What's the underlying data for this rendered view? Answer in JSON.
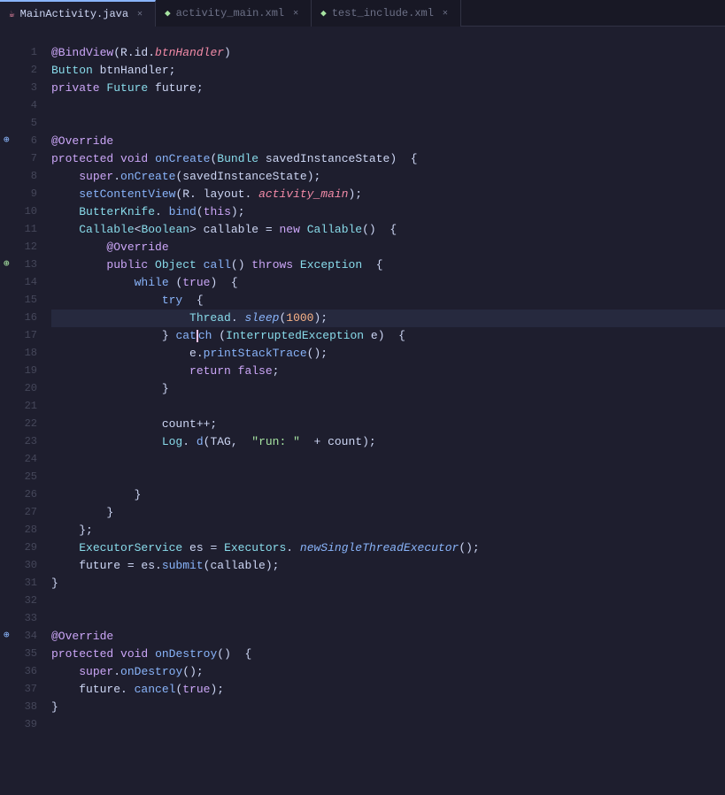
{
  "tabs": [
    {
      "id": "main-activity",
      "label": "MainActivity.java",
      "type": "java",
      "active": true
    },
    {
      "id": "activity-main-xml",
      "label": "activity_main.xml",
      "type": "xml",
      "active": false
    },
    {
      "id": "test-include-xml",
      "label": "test_include.xml",
      "type": "xml",
      "active": false
    }
  ],
  "lines": [
    {
      "num": "",
      "indent": 0,
      "content_html": ""
    },
    {
      "num": "1",
      "code": "@BindView(R.id.btnHandler)",
      "gutter_icon": null
    },
    {
      "num": "2",
      "code": "Button btnHandler;"
    },
    {
      "num": "3",
      "code": "private Future future;"
    },
    {
      "num": "4",
      "code": ""
    },
    {
      "num": "5",
      "code": ""
    },
    {
      "num": "6",
      "code": "@Override",
      "gutter_icon": "method"
    },
    {
      "num": "7",
      "code": "protected void onCreate(Bundle savedInstanceState)  {"
    },
    {
      "num": "8",
      "code": "    super.onCreate(savedInstanceState);"
    },
    {
      "num": "9",
      "code": "    setContentView(R. layout. activity_main);"
    },
    {
      "num": "10",
      "code": "    ButterKnife. bind(this);"
    },
    {
      "num": "11",
      "code": "    Callable<Boolean> callable = new Callable()  {"
    },
    {
      "num": "12",
      "code": "        @Override"
    },
    {
      "num": "13",
      "code": "        public Object call() throws Exception  {",
      "gutter_icon": "method_green"
    },
    {
      "num": "14",
      "code": "            while (true)  {"
    },
    {
      "num": "15",
      "code": "                try  {"
    },
    {
      "num": "16",
      "code": "                    Thread. sleep(1000);"
    },
    {
      "num": "17",
      "code": "                } catch (InterruptedException e)  {"
    },
    {
      "num": "18",
      "code": "                    e.printStackTrace();"
    },
    {
      "num": "19",
      "code": "                    return false;"
    },
    {
      "num": "20",
      "code": "                }"
    },
    {
      "num": "21",
      "code": ""
    },
    {
      "num": "22",
      "code": "                count++;"
    },
    {
      "num": "23",
      "code": "                Log. d(TAG,  \"run: \"  + count);"
    },
    {
      "num": "24",
      "code": ""
    },
    {
      "num": "25",
      "code": ""
    },
    {
      "num": "26",
      "code": "            }"
    },
    {
      "num": "27",
      "code": "        }"
    },
    {
      "num": "28",
      "code": "    };"
    },
    {
      "num": "29",
      "code": "    ExecutorService es = Executors. newSingleThreadExecutor();"
    },
    {
      "num": "30",
      "code": "    future = es.submit(callable);"
    },
    {
      "num": "31",
      "code": "}"
    },
    {
      "num": "32",
      "code": ""
    },
    {
      "num": "33",
      "code": ""
    },
    {
      "num": "34",
      "code": "@Override",
      "gutter_icon": "method"
    },
    {
      "num": "35",
      "code": "protected void onDestroy()  {"
    },
    {
      "num": "36",
      "code": "    super.onDestroy();"
    },
    {
      "num": "37",
      "code": "    future. cancel(true);"
    },
    {
      "num": "38",
      "code": "}"
    },
    {
      "num": "39",
      "code": ""
    }
  ]
}
